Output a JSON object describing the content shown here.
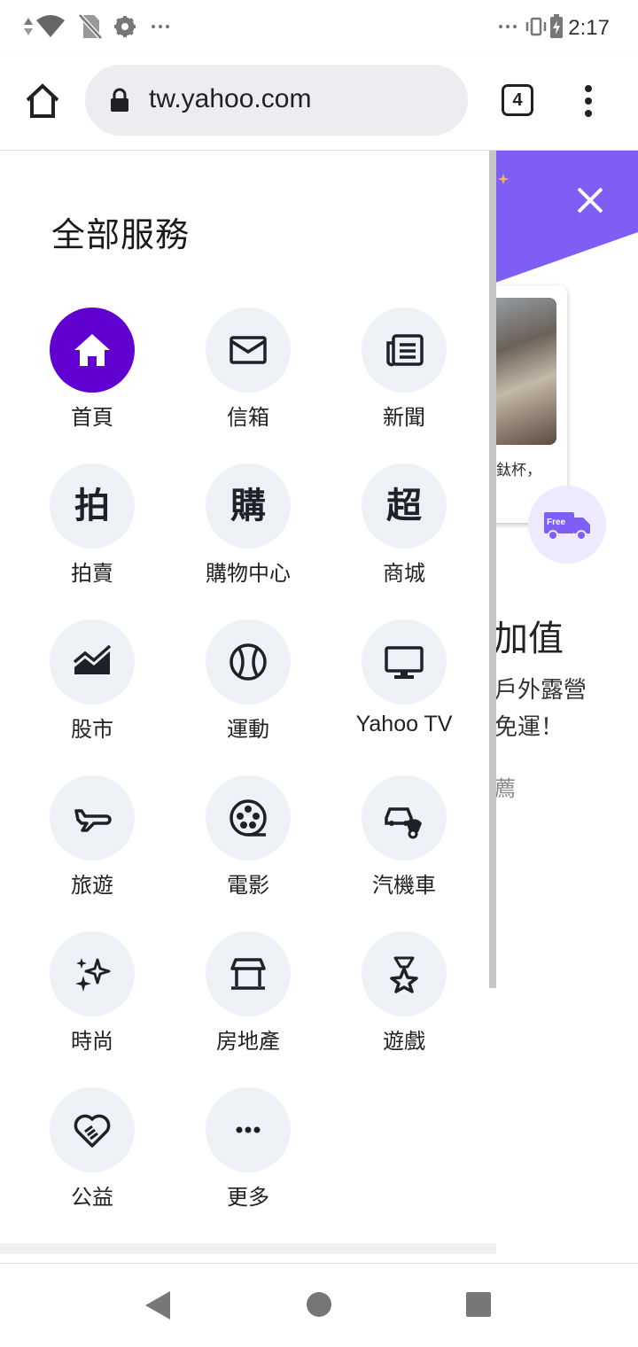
{
  "status_bar": {
    "time": "2:17",
    "left_icons": [
      "signal-arrows-icon",
      "wifi-icon",
      "no-sim-icon",
      "gear-icon",
      "more-dots-icon"
    ],
    "right_icons": [
      "more-dots-icon",
      "vibrate-icon",
      "battery-charging-icon"
    ]
  },
  "browser": {
    "url": "tw.yahoo.com",
    "tab_count": "4",
    "icons": [
      "home-icon",
      "lock-icon",
      "tabs-icon",
      "overflow-menu-icon"
    ]
  },
  "drawer": {
    "title": "全部服務",
    "accent_color": "#6001d2",
    "services": [
      {
        "label": "首頁",
        "icon": "home-icon"
      },
      {
        "label": "信箱",
        "icon": "mail-icon"
      },
      {
        "label": "新聞",
        "icon": "news-icon"
      },
      {
        "label": "拍賣",
        "icon": "auction-icon",
        "glyph": "拍"
      },
      {
        "label": "購物中心",
        "icon": "shopping-icon",
        "glyph": "購"
      },
      {
        "label": "商城",
        "icon": "mall-icon",
        "glyph": "超"
      },
      {
        "label": "股市",
        "icon": "stock-chart-icon"
      },
      {
        "label": "運動",
        "icon": "baseball-icon"
      },
      {
        "label": "Yahoo TV",
        "icon": "tv-monitor-icon"
      },
      {
        "label": "旅遊",
        "icon": "airplane-icon"
      },
      {
        "label": "電影",
        "icon": "film-reel-icon"
      },
      {
        "label": "汽機車",
        "icon": "car-scooter-icon"
      },
      {
        "label": "時尚",
        "icon": "sparkles-icon"
      },
      {
        "label": "房地產",
        "icon": "house-icon"
      },
      {
        "label": "遊戲",
        "icon": "game-star-icon"
      },
      {
        "label": "公益",
        "icon": "heart-hand-icon"
      },
      {
        "label": "更多",
        "icon": "more-dots-icon"
      }
    ]
  },
  "background_page": {
    "card_text": "鈦杯，",
    "badge_text": "Free",
    "headline": "加值",
    "line1": "戶外露營",
    "line2": "免運！",
    "small": "薦"
  },
  "nav_bar": {
    "icons": [
      "back-triangle-icon",
      "home-circle-icon",
      "recents-square-icon"
    ]
  }
}
